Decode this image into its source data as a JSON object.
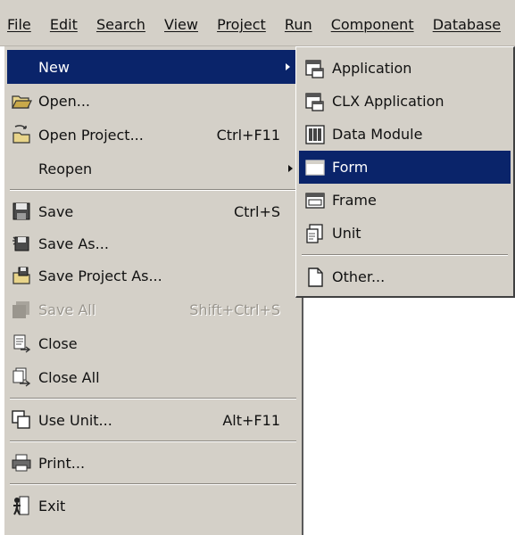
{
  "menubar": {
    "items": [
      "File",
      "Edit",
      "Search",
      "View",
      "Project",
      "Run",
      "Component",
      "Database"
    ]
  },
  "file_menu": {
    "items": {
      "new": {
        "label": "New",
        "icon": "none"
      },
      "open": {
        "label": "Open...",
        "icon": "open-folder-icon"
      },
      "open_project": {
        "label": "Open Project...",
        "shortcut": "Ctrl+F11",
        "icon": "open-project-icon"
      },
      "reopen": {
        "label": "Reopen",
        "icon": "none"
      },
      "save": {
        "label": "Save",
        "shortcut": "Ctrl+S",
        "icon": "floppy-disk-icon"
      },
      "save_as": {
        "label": "Save As...",
        "icon": "save-as-icon"
      },
      "save_project_as": {
        "label": "Save Project As...",
        "icon": "save-project-icon"
      },
      "save_all": {
        "label": "Save All",
        "shortcut": "Shift+Ctrl+S",
        "icon": "save-all-icon"
      },
      "close": {
        "label": "Close",
        "icon": "close-file-icon"
      },
      "close_all": {
        "label": "Close All",
        "icon": "close-all-icon"
      },
      "use_unit": {
        "label": "Use Unit...",
        "shortcut": "Alt+F11",
        "icon": "use-unit-icon"
      },
      "print": {
        "label": "Print...",
        "icon": "printer-icon"
      },
      "exit": {
        "label": "Exit",
        "icon": "exit-door-icon"
      }
    }
  },
  "new_submenu": {
    "items": {
      "application": {
        "label": "Application",
        "icon": "application-icon"
      },
      "clx_application": {
        "label": "CLX Application",
        "icon": "clx-application-icon"
      },
      "data_module": {
        "label": "Data Module",
        "icon": "data-module-icon"
      },
      "form": {
        "label": "Form",
        "icon": "form-icon"
      },
      "frame": {
        "label": "Frame",
        "icon": "frame-icon"
      },
      "unit": {
        "label": "Unit",
        "icon": "unit-icon"
      },
      "other": {
        "label": "Other...",
        "icon": "blank-page-icon"
      }
    }
  },
  "colors": {
    "menu_background": "#d4d0c8",
    "highlight": "#0a246a",
    "highlight_text": "#ffffff",
    "disabled_text": "#9a968e"
  }
}
